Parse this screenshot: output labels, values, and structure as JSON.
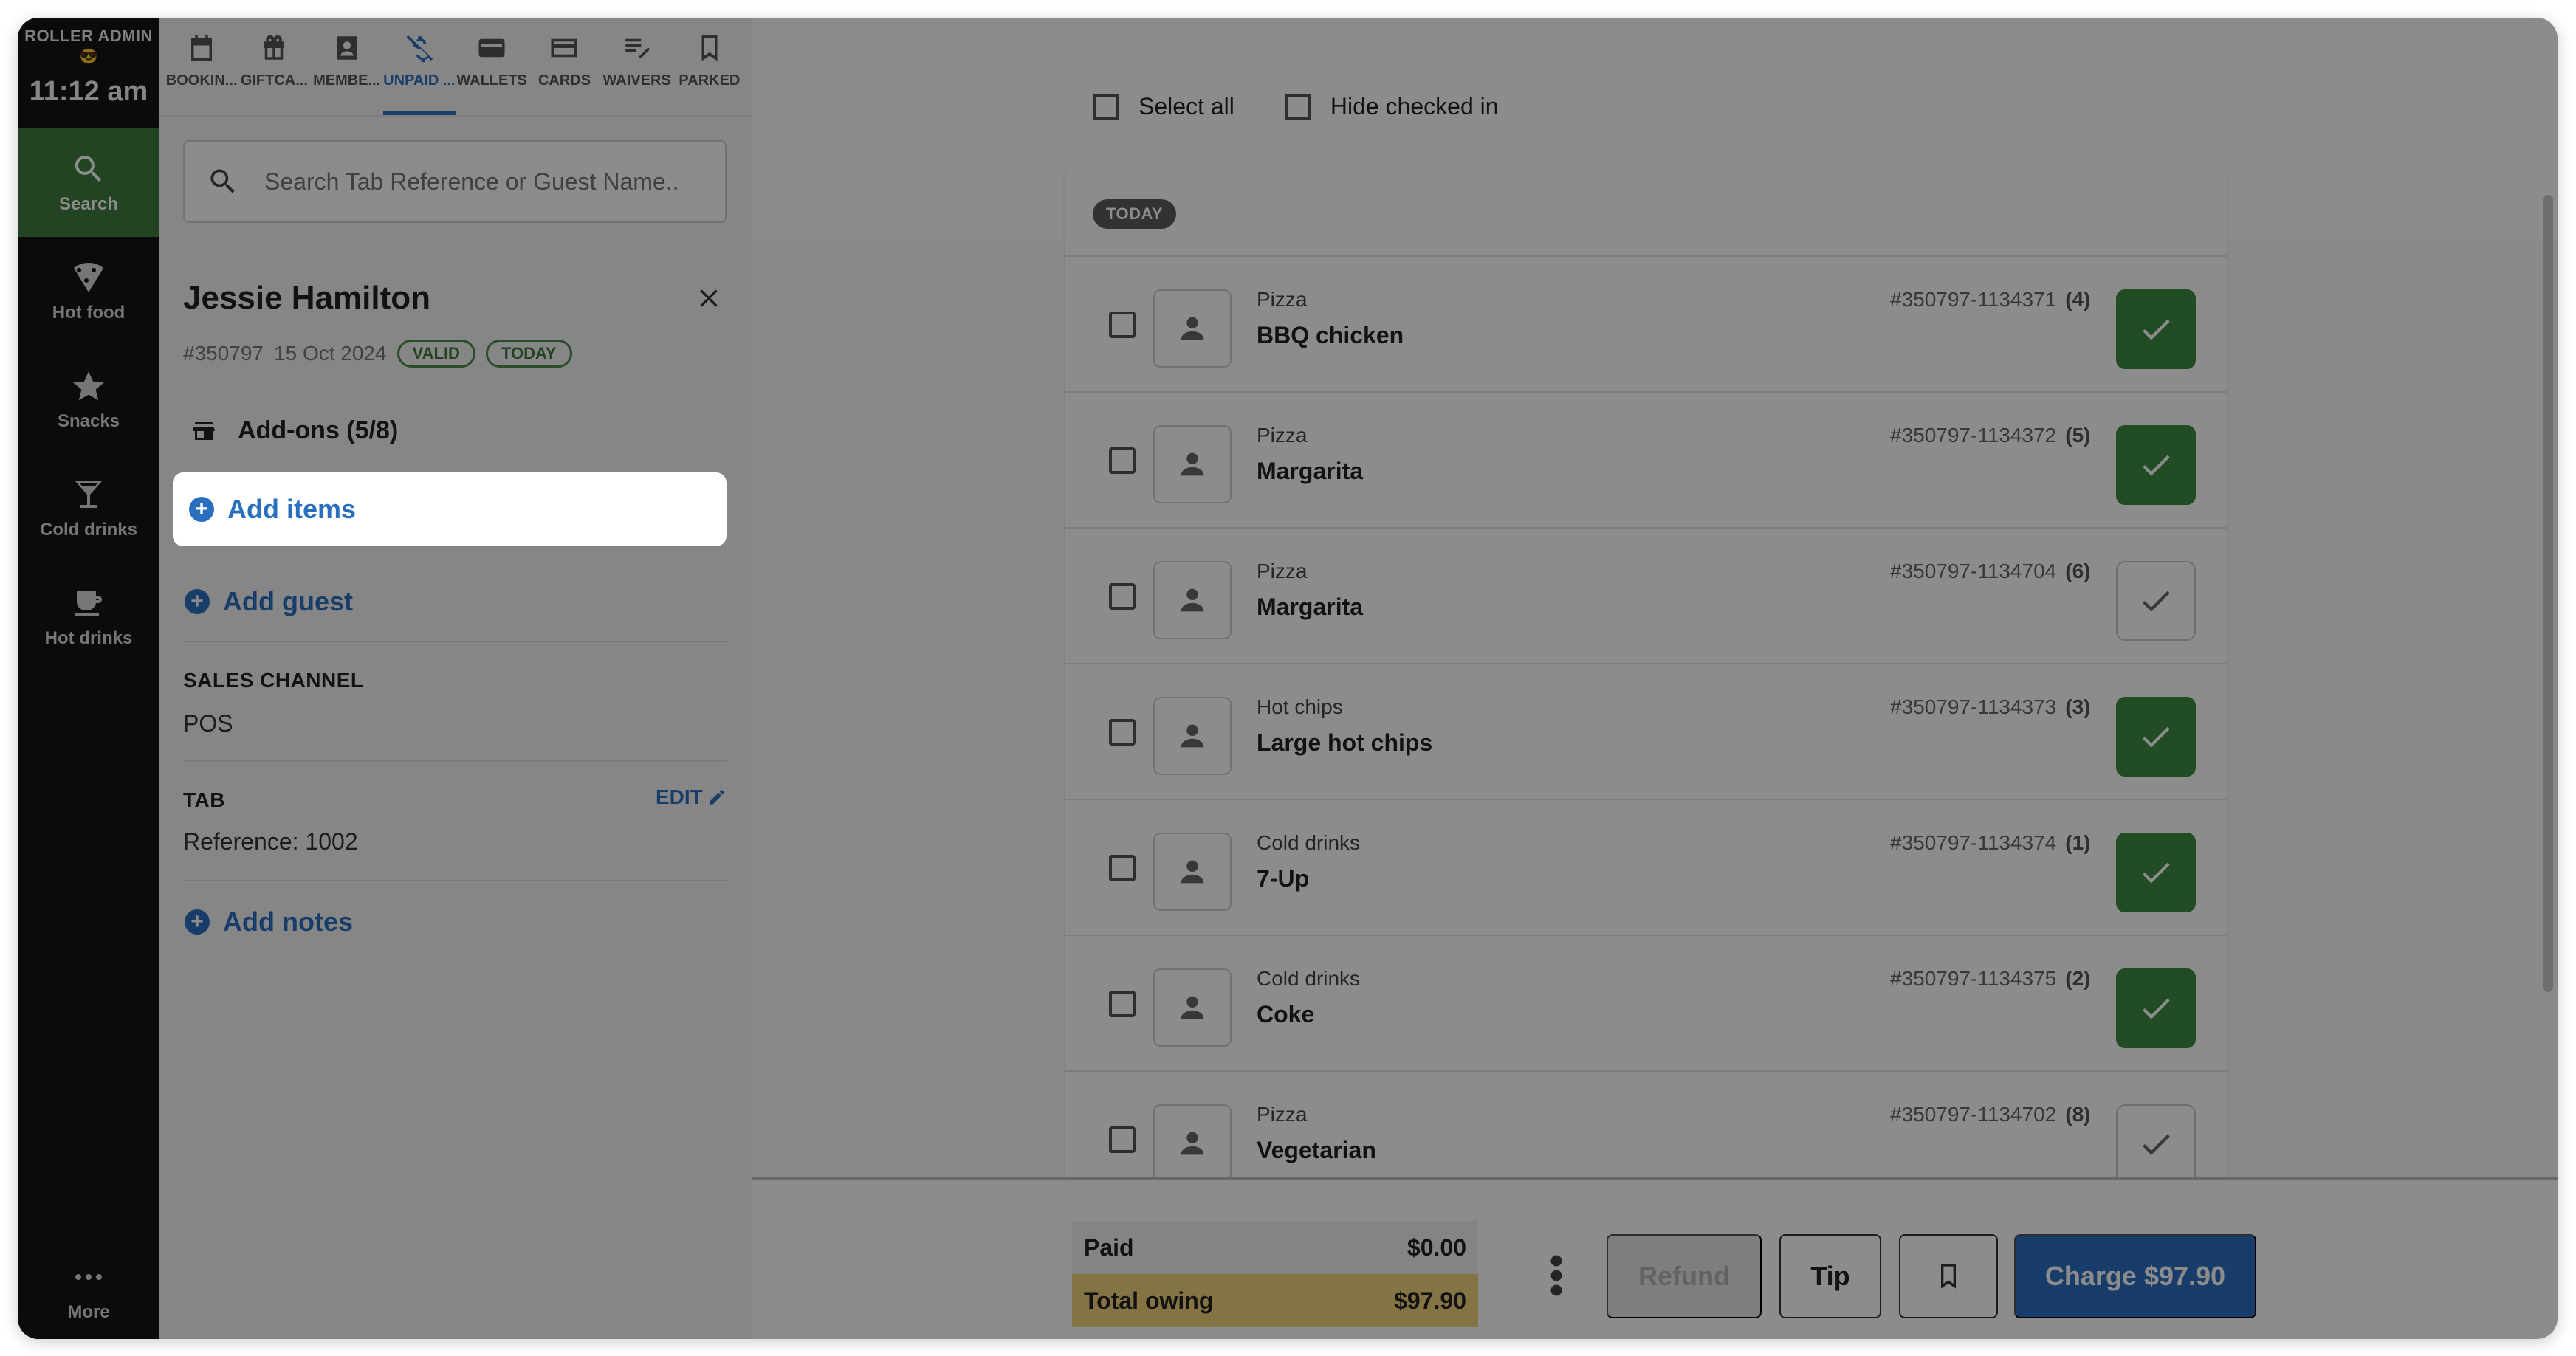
{
  "rail": {
    "org": "ROLLER ADMIN",
    "time": "11:12 am",
    "items": [
      {
        "label": "Search",
        "icon": "search-icon"
      },
      {
        "label": "Hot food",
        "icon": "pizza-icon"
      },
      {
        "label": "Snacks",
        "icon": "star-icon"
      },
      {
        "label": "Cold drinks",
        "icon": "cocktail-icon"
      },
      {
        "label": "Hot drinks",
        "icon": "coffee-icon"
      }
    ],
    "more": "More"
  },
  "tabs": [
    {
      "label": "BOOKIN...",
      "icon": "calendar-icon"
    },
    {
      "label": "GIFTCA...",
      "icon": "gift-icon"
    },
    {
      "label": "MEMBE...",
      "icon": "member-badge-icon"
    },
    {
      "label": "UNPAID ...",
      "icon": "no-money-icon"
    },
    {
      "label": "WALLETS",
      "icon": "wallet-icon"
    },
    {
      "label": "CARDS",
      "icon": "card-icon"
    },
    {
      "label": "WAIVERS",
      "icon": "waiver-icon"
    },
    {
      "label": "PARKED",
      "icon": "bookmark-icon"
    }
  ],
  "search": {
    "placeholder": "Search Tab Reference or Guest Name..."
  },
  "guest": {
    "name": "Jessie Hamilton",
    "number": "#350797",
    "date": "15 Oct 2024",
    "badge_valid": "VALID",
    "badge_today": "TODAY",
    "addons": "Add-ons (5/8)",
    "add_items": "Add items",
    "add_guest": "Add guest",
    "sales_channel_label": "SALES CHANNEL",
    "sales_channel_value": "POS",
    "tab_label": "TAB",
    "edit": "EDIT",
    "tab_reference": "Reference: 1002",
    "add_notes": "Add notes"
  },
  "list": {
    "select_all": "Select all",
    "hide_checked_in": "Hide checked in",
    "group": "TODAY",
    "items": [
      {
        "category": "Pizza",
        "name": "BBQ chicken",
        "ref": "#350797-1134371",
        "qty": "(4)",
        "checked": true
      },
      {
        "category": "Pizza",
        "name": "Margarita",
        "ref": "#350797-1134372",
        "qty": "(5)",
        "checked": true
      },
      {
        "category": "Pizza",
        "name": "Margarita",
        "ref": "#350797-1134704",
        "qty": "(6)",
        "checked": false
      },
      {
        "category": "Hot chips",
        "name": "Large hot chips",
        "ref": "#350797-1134373",
        "qty": "(3)",
        "checked": true
      },
      {
        "category": "Cold drinks",
        "name": "7-Up",
        "ref": "#350797-1134374",
        "qty": "(1)",
        "checked": true
      },
      {
        "category": "Cold drinks",
        "name": "Coke",
        "ref": "#350797-1134375",
        "qty": "(2)",
        "checked": true
      },
      {
        "category": "Pizza",
        "name": "Vegetarian",
        "ref": "#350797-1134702",
        "qty": "(8)",
        "checked": false
      }
    ]
  },
  "footer": {
    "paid_label": "Paid",
    "paid_value": "$0.00",
    "owing_label": "Total owing",
    "owing_value": "$97.90",
    "refund": "Refund",
    "tip": "Tip",
    "charge": "Charge $97.90"
  },
  "colors": {
    "accent": "#2a6fbd",
    "active_rail": "#3f7d3f",
    "checked": "#3f8d42",
    "owing": "#f1d27a"
  }
}
